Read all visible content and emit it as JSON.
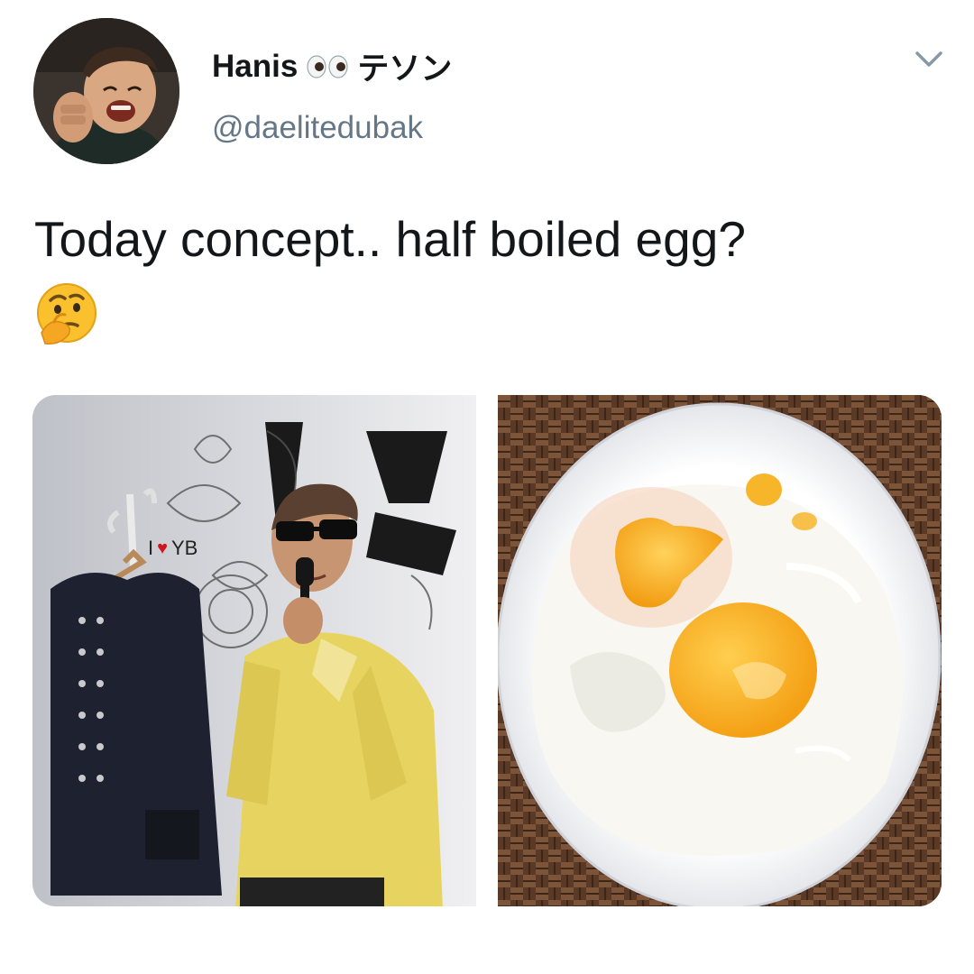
{
  "tweet": {
    "author": {
      "display_name": "Hanis",
      "display_name_suffix": "テソン",
      "handle": "@daelitedubak",
      "avatar_icon": "user-avatar-photo",
      "name_emoji_icon": "eyes-emoji-icon"
    },
    "menu_icon": "chevron-down-icon",
    "text": "Today concept.. half boiled egg?",
    "text_emoji_icon": "thinking-face-emoji-icon",
    "media": [
      {
        "kind": "photo",
        "name": "performer-photo",
        "sign_prefix": "I",
        "sign_suffix": "YB",
        "sign_heart": "♥"
      },
      {
        "kind": "photo",
        "name": "egg-photo"
      }
    ]
  },
  "colors": {
    "text": "#14171a",
    "handle": "#657786",
    "heart": "#d0161d",
    "egg_yolk": "#f6a312",
    "shirt": "#e6d15f"
  }
}
